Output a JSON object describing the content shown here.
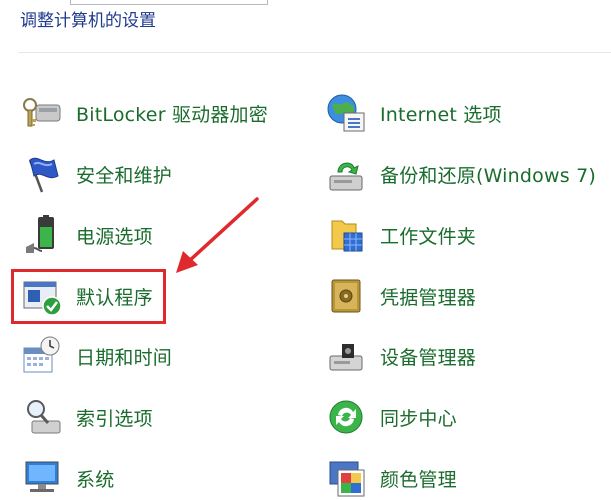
{
  "header": {
    "title": "调整计算机的设置"
  },
  "items_left": [
    {
      "label": "BitLocker 驱动器加密",
      "icon": "bitlocker-icon"
    },
    {
      "label": "安全和维护",
      "icon": "security-flag-icon"
    },
    {
      "label": "电源选项",
      "icon": "power-options-icon"
    },
    {
      "label": "默认程序",
      "icon": "default-programs-icon"
    },
    {
      "label": "日期和时间",
      "icon": "date-time-icon"
    },
    {
      "label": "索引选项",
      "icon": "indexing-icon"
    },
    {
      "label": "系统",
      "icon": "system-icon"
    }
  ],
  "items_right": [
    {
      "label": "Internet 选项",
      "icon": "internet-options-icon"
    },
    {
      "label": "备份和还原(Windows 7)",
      "icon": "backup-restore-icon"
    },
    {
      "label": "工作文件夹",
      "icon": "work-folders-icon"
    },
    {
      "label": "凭据管理器",
      "icon": "credential-manager-icon"
    },
    {
      "label": "设备管理器",
      "icon": "device-manager-icon"
    },
    {
      "label": "同步中心",
      "icon": "sync-center-icon"
    },
    {
      "label": "颜色管理",
      "icon": "color-management-icon"
    }
  ],
  "colors": {
    "link_green": "#1a6c2d",
    "header_blue": "#1e3a8c",
    "highlight_red": "#e0292c"
  }
}
